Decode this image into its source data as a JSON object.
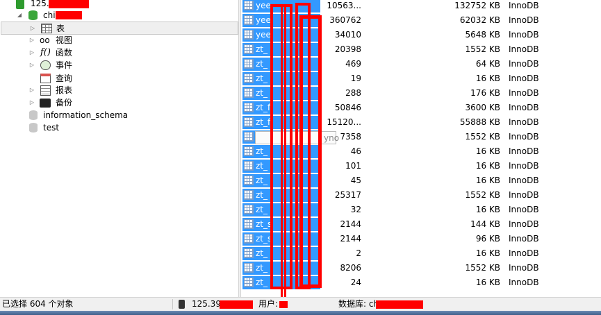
{
  "tree": {
    "connection": {
      "label": "125."
    },
    "database": {
      "label": "chi"
    },
    "items": [
      {
        "label": "表",
        "icon": "table-icon"
      },
      {
        "label": "视图",
        "icon": "glasses-icon"
      },
      {
        "label": "函数",
        "icon": "function-icon"
      },
      {
        "label": "事件",
        "icon": "event-clock-icon"
      },
      {
        "label": "查询",
        "icon": "query-icon"
      },
      {
        "label": "报表",
        "icon": "report-icon"
      },
      {
        "label": "备份",
        "icon": "backup-icon"
      }
    ],
    "other_databases": [
      {
        "label": "information_schema"
      },
      {
        "label": "test"
      }
    ]
  },
  "tables": {
    "rows": [
      {
        "name": "yee",
        "rows": "10563...",
        "size": "132752 KB",
        "engine": "InnoDB"
      },
      {
        "name": "yee",
        "rows": "360762",
        "size": "62032 KB",
        "engine": "InnoDB"
      },
      {
        "name": "yee",
        "rows": "34010",
        "size": "5648 KB",
        "engine": "InnoDB"
      },
      {
        "name": "zt_",
        "rows": "20398",
        "size": "1552 KB",
        "engine": "InnoDB"
      },
      {
        "name": "zt_",
        "rows": "469",
        "size": "64 KB",
        "engine": "InnoDB"
      },
      {
        "name": "zt_",
        "rows": "19",
        "size": "16 KB",
        "engine": "InnoDB"
      },
      {
        "name": "zt_",
        "rows": "288",
        "size": "176 KB",
        "engine": "InnoDB"
      },
      {
        "name": "zt_f",
        "rows": "50846",
        "size": "3600 KB",
        "engine": "InnoDB"
      },
      {
        "name": "zt_f",
        "rows": "15120...",
        "size": "55888 KB",
        "engine": "InnoDB"
      },
      {
        "name": "",
        "rows": "7358",
        "size": "1552 KB",
        "engine": "InnoDB"
      },
      {
        "name": "zt_",
        "rows": "46",
        "size": "16 KB",
        "engine": "InnoDB"
      },
      {
        "name": "zt_",
        "rows": "101",
        "size": "16 KB",
        "engine": "InnoDB"
      },
      {
        "name": "zt_",
        "rows": "45",
        "size": "16 KB",
        "engine": "InnoDB"
      },
      {
        "name": "zt_",
        "rows": "25317",
        "size": "1552 KB",
        "engine": "InnoDB"
      },
      {
        "name": "zt_",
        "rows": "32",
        "size": "16 KB",
        "engine": "InnoDB"
      },
      {
        "name": "zt_s",
        "rows": "2144",
        "size": "144 KB",
        "engine": "InnoDB"
      },
      {
        "name": "zt_s",
        "rows": "2144",
        "size": "96 KB",
        "engine": "InnoDB"
      },
      {
        "name": "zt_",
        "rows": "2",
        "size": "16 KB",
        "engine": "InnoDB"
      },
      {
        "name": "zt_",
        "rows": "8206",
        "size": "1552 KB",
        "engine": "InnoDB"
      },
      {
        "name": "zt_",
        "rows": "24",
        "size": "16 KB",
        "engine": "InnoDB"
      }
    ],
    "tooltip": "yno"
  },
  "status": {
    "selection": "已选择 604 个对象",
    "host": "125.39",
    "user_label": "用户:",
    "db_label": "数据库: ch"
  },
  "colors": {
    "selection": "#3399ff",
    "redaction": "#ff0000"
  }
}
